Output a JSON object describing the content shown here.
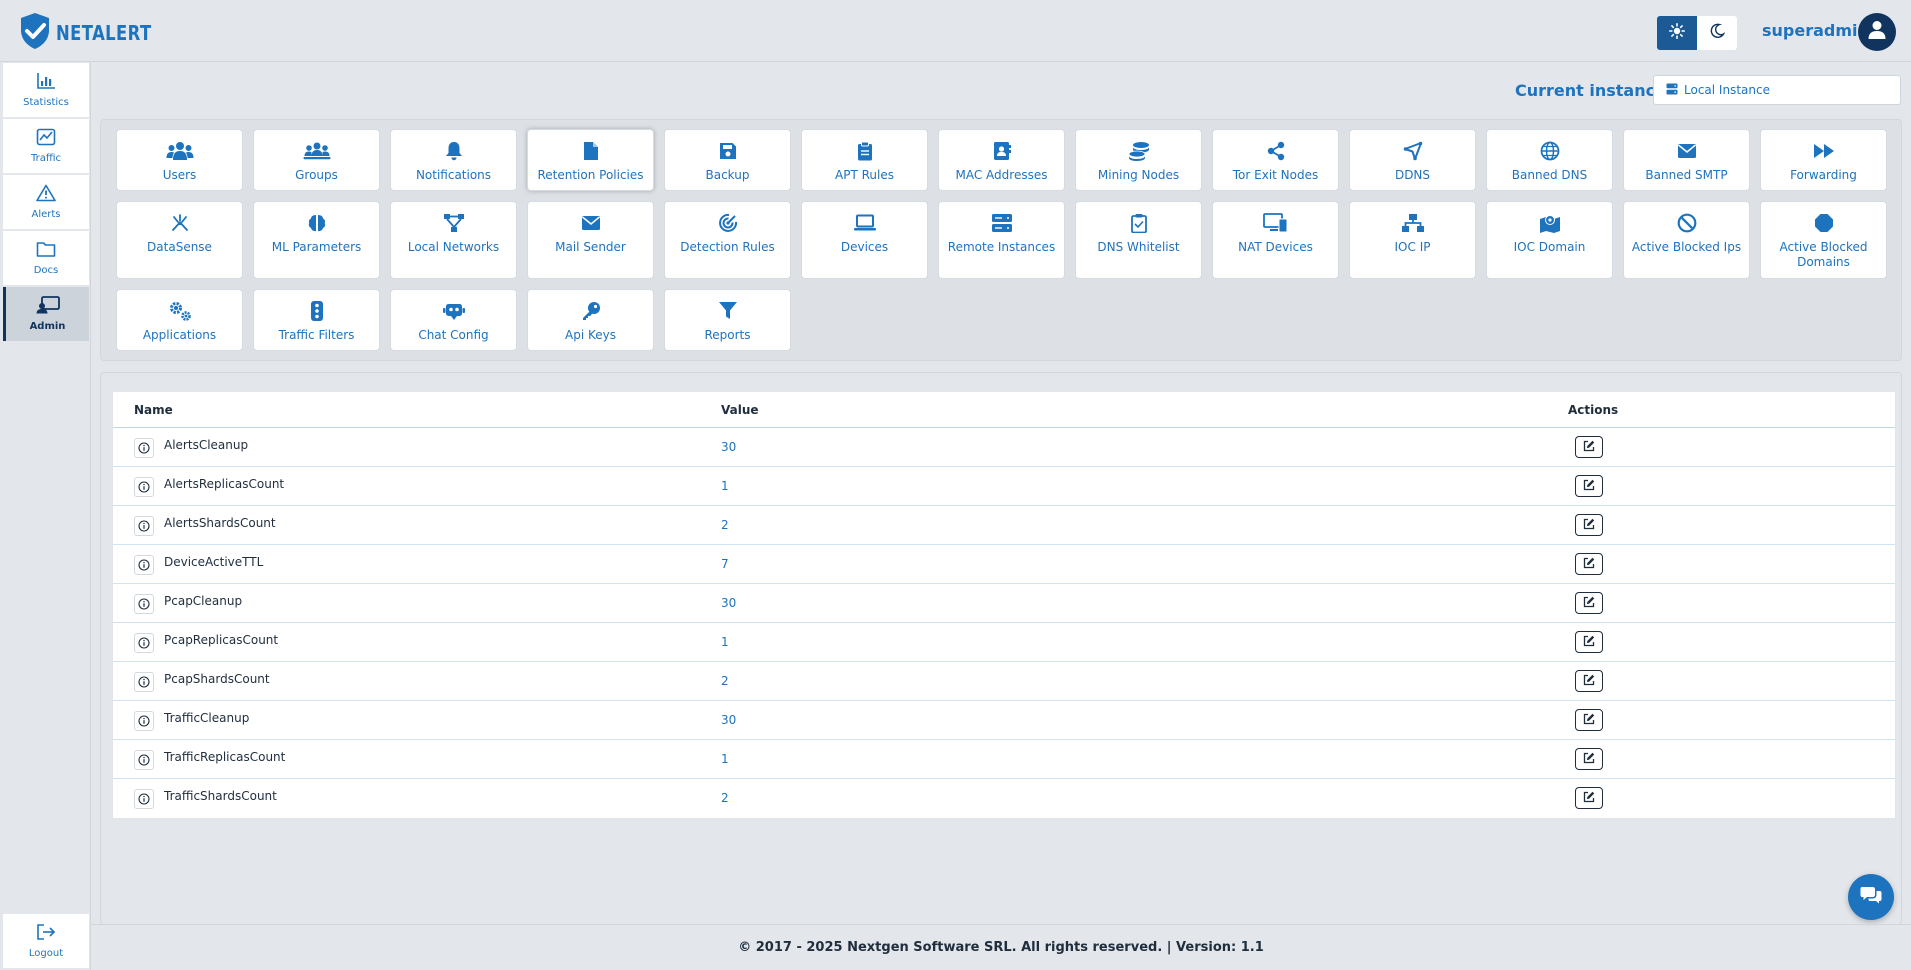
{
  "brand": {
    "name": "NETALERT"
  },
  "header": {
    "username": "superadmin",
    "theme": {
      "light_icon": "sun-icon",
      "dark_icon": "moon-icon"
    }
  },
  "sidebar": {
    "items": [
      {
        "label": "Statistics",
        "icon": "bar-chart-icon"
      },
      {
        "label": "Traffic",
        "icon": "line-chart-icon"
      },
      {
        "label": "Alerts",
        "icon": "warning-icon"
      },
      {
        "label": "Docs",
        "icon": "folder-icon"
      },
      {
        "label": "Admin",
        "icon": "admin-screen-icon",
        "active": true
      }
    ],
    "logout": {
      "label": "Logout",
      "icon": "logout-icon"
    }
  },
  "instance": {
    "label": "Current instance:",
    "selected": "Local Instance"
  },
  "admin_tiles": [
    [
      "Users",
      "Groups",
      "Notifications",
      "Retention Policies",
      "Backup",
      "APT Rules",
      "MAC Addresses",
      "Mining Nodes",
      "Tor Exit Nodes",
      "DDNS",
      "Banned DNS",
      "Banned SMTP",
      "Forwarding"
    ],
    [
      "DataSense",
      "ML Parameters",
      "Local Networks",
      "Mail Sender",
      "Detection Rules",
      "Devices",
      "Remote Instances",
      "DNS Whitelist",
      "NAT Devices",
      "IOC IP",
      "IOC Domain",
      "Active Blocked Ips",
      "Active Blocked Domains"
    ],
    [
      "Applications",
      "Traffic Filters",
      "Chat Config",
      "Api Keys",
      "Reports"
    ]
  ],
  "selected_tile": "Retention Policies",
  "table": {
    "headers": {
      "name": "Name",
      "value": "Value",
      "actions": "Actions"
    },
    "rows": [
      {
        "name": "AlertsCleanup",
        "value": "30"
      },
      {
        "name": "AlertsReplicasCount",
        "value": "1"
      },
      {
        "name": "AlertsShardsCount",
        "value": "2"
      },
      {
        "name": "DeviceActiveTTL",
        "value": "7"
      },
      {
        "name": "PcapCleanup",
        "value": "30"
      },
      {
        "name": "PcapReplicasCount",
        "value": "1"
      },
      {
        "name": "PcapShardsCount",
        "value": "2"
      },
      {
        "name": "TrafficCleanup",
        "value": "30"
      },
      {
        "name": "TrafficReplicasCount",
        "value": "1"
      },
      {
        "name": "TrafficShardsCount",
        "value": "2"
      }
    ]
  },
  "footer": {
    "text": "© 2017 - 2025 Nextgen Software SRL. All rights reserved. | Version: 1.1"
  },
  "colors": {
    "accent": "#1e73be",
    "dark": "#10345e",
    "background": "#e3e6ea"
  }
}
